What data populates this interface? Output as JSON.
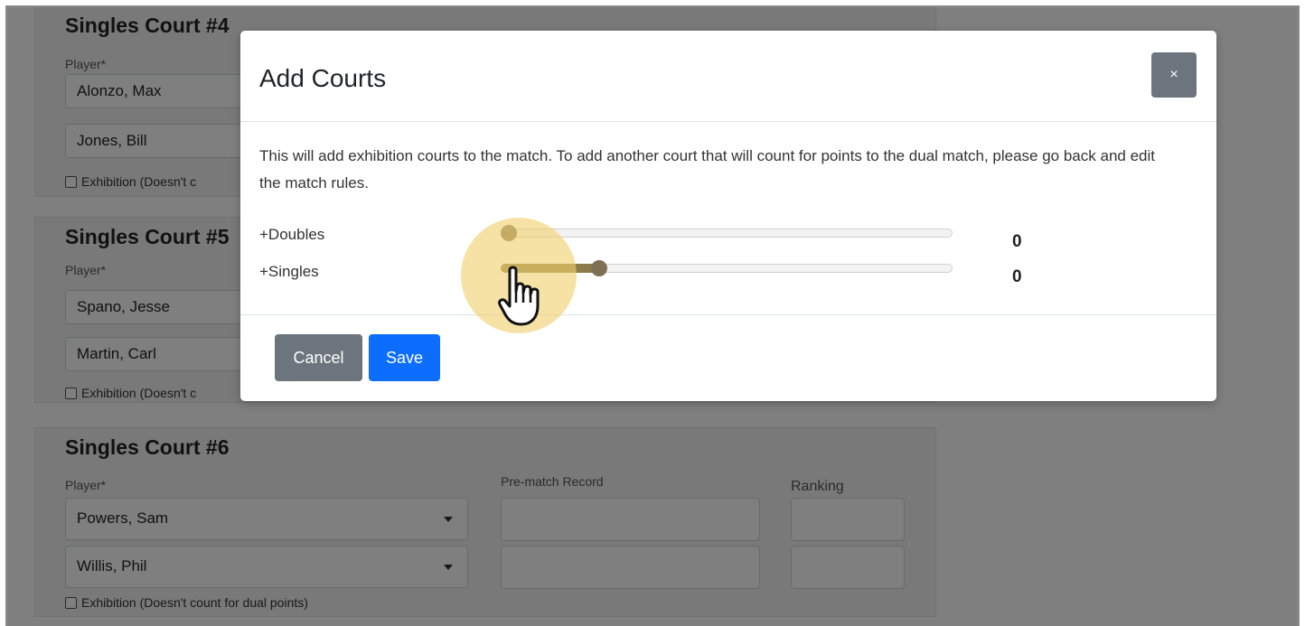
{
  "background_courts": [
    {
      "title": "Singles Court #4",
      "player_label": "Player*",
      "players": [
        "Alonzo, Max",
        "Jones, Bill"
      ],
      "exhibition_label": "Exhibition (Doesn't c"
    },
    {
      "title": "Singles Court #5",
      "player_label": "Player*",
      "players": [
        "Spano, Jesse",
        "Martin, Carl"
      ],
      "exhibition_label": "Exhibition (Doesn't c"
    },
    {
      "title": "Singles Court #6",
      "player_label": "Player*",
      "record_label": "Pre-match Record",
      "ranking_label": "Ranking",
      "players": [
        "Powers, Sam",
        "Willis, Phil"
      ],
      "exhibition_label": "Exhibition (Doesn't count for dual points)"
    }
  ],
  "modal": {
    "title": "Add Courts",
    "close_label": "×",
    "description": "This will add exhibition courts to the match. To add another court that will count for points to the dual match, please go back and edit the match rules.",
    "sliders": [
      {
        "label": "+Doubles",
        "value": "0",
        "fill_fraction": 0.0
      },
      {
        "label": "+Singles",
        "value": "0",
        "fill_fraction": 0.2
      }
    ],
    "cancel_label": "Cancel",
    "save_label": "Save"
  },
  "colors": {
    "backdrop": "rgba(0,0,0,0.5)",
    "primary_button": "#0d6efd",
    "secondary_button": "#6c757d",
    "cursor_highlight": "#f0d06e"
  },
  "cursor": {
    "icon": "pointer-hand-icon"
  }
}
